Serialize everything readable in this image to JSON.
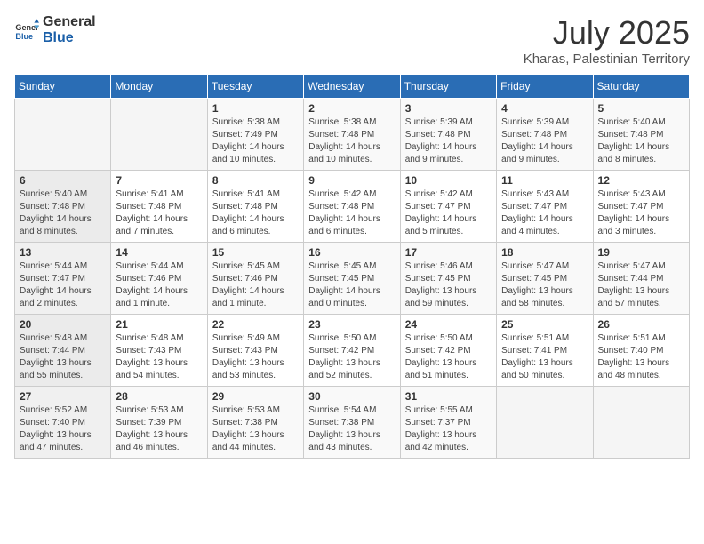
{
  "logo": {
    "line1": "General",
    "line2": "Blue"
  },
  "title": "July 2025",
  "subtitle": "Kharas, Palestinian Territory",
  "days_of_week": [
    "Sunday",
    "Monday",
    "Tuesday",
    "Wednesday",
    "Thursday",
    "Friday",
    "Saturday"
  ],
  "weeks": [
    [
      {
        "day": "",
        "info": ""
      },
      {
        "day": "",
        "info": ""
      },
      {
        "day": "1",
        "info": "Sunrise: 5:38 AM\nSunset: 7:49 PM\nDaylight: 14 hours and 10 minutes."
      },
      {
        "day": "2",
        "info": "Sunrise: 5:38 AM\nSunset: 7:48 PM\nDaylight: 14 hours and 10 minutes."
      },
      {
        "day": "3",
        "info": "Sunrise: 5:39 AM\nSunset: 7:48 PM\nDaylight: 14 hours and 9 minutes."
      },
      {
        "day": "4",
        "info": "Sunrise: 5:39 AM\nSunset: 7:48 PM\nDaylight: 14 hours and 9 minutes."
      },
      {
        "day": "5",
        "info": "Sunrise: 5:40 AM\nSunset: 7:48 PM\nDaylight: 14 hours and 8 minutes."
      }
    ],
    [
      {
        "day": "6",
        "info": "Sunrise: 5:40 AM\nSunset: 7:48 PM\nDaylight: 14 hours and 8 minutes."
      },
      {
        "day": "7",
        "info": "Sunrise: 5:41 AM\nSunset: 7:48 PM\nDaylight: 14 hours and 7 minutes."
      },
      {
        "day": "8",
        "info": "Sunrise: 5:41 AM\nSunset: 7:48 PM\nDaylight: 14 hours and 6 minutes."
      },
      {
        "day": "9",
        "info": "Sunrise: 5:42 AM\nSunset: 7:48 PM\nDaylight: 14 hours and 6 minutes."
      },
      {
        "day": "10",
        "info": "Sunrise: 5:42 AM\nSunset: 7:47 PM\nDaylight: 14 hours and 5 minutes."
      },
      {
        "day": "11",
        "info": "Sunrise: 5:43 AM\nSunset: 7:47 PM\nDaylight: 14 hours and 4 minutes."
      },
      {
        "day": "12",
        "info": "Sunrise: 5:43 AM\nSunset: 7:47 PM\nDaylight: 14 hours and 3 minutes."
      }
    ],
    [
      {
        "day": "13",
        "info": "Sunrise: 5:44 AM\nSunset: 7:47 PM\nDaylight: 14 hours and 2 minutes."
      },
      {
        "day": "14",
        "info": "Sunrise: 5:44 AM\nSunset: 7:46 PM\nDaylight: 14 hours and 1 minute."
      },
      {
        "day": "15",
        "info": "Sunrise: 5:45 AM\nSunset: 7:46 PM\nDaylight: 14 hours and 1 minute."
      },
      {
        "day": "16",
        "info": "Sunrise: 5:45 AM\nSunset: 7:45 PM\nDaylight: 14 hours and 0 minutes."
      },
      {
        "day": "17",
        "info": "Sunrise: 5:46 AM\nSunset: 7:45 PM\nDaylight: 13 hours and 59 minutes."
      },
      {
        "day": "18",
        "info": "Sunrise: 5:47 AM\nSunset: 7:45 PM\nDaylight: 13 hours and 58 minutes."
      },
      {
        "day": "19",
        "info": "Sunrise: 5:47 AM\nSunset: 7:44 PM\nDaylight: 13 hours and 57 minutes."
      }
    ],
    [
      {
        "day": "20",
        "info": "Sunrise: 5:48 AM\nSunset: 7:44 PM\nDaylight: 13 hours and 55 minutes."
      },
      {
        "day": "21",
        "info": "Sunrise: 5:48 AM\nSunset: 7:43 PM\nDaylight: 13 hours and 54 minutes."
      },
      {
        "day": "22",
        "info": "Sunrise: 5:49 AM\nSunset: 7:43 PM\nDaylight: 13 hours and 53 minutes."
      },
      {
        "day": "23",
        "info": "Sunrise: 5:50 AM\nSunset: 7:42 PM\nDaylight: 13 hours and 52 minutes."
      },
      {
        "day": "24",
        "info": "Sunrise: 5:50 AM\nSunset: 7:42 PM\nDaylight: 13 hours and 51 minutes."
      },
      {
        "day": "25",
        "info": "Sunrise: 5:51 AM\nSunset: 7:41 PM\nDaylight: 13 hours and 50 minutes."
      },
      {
        "day": "26",
        "info": "Sunrise: 5:51 AM\nSunset: 7:40 PM\nDaylight: 13 hours and 48 minutes."
      }
    ],
    [
      {
        "day": "27",
        "info": "Sunrise: 5:52 AM\nSunset: 7:40 PM\nDaylight: 13 hours and 47 minutes."
      },
      {
        "day": "28",
        "info": "Sunrise: 5:53 AM\nSunset: 7:39 PM\nDaylight: 13 hours and 46 minutes."
      },
      {
        "day": "29",
        "info": "Sunrise: 5:53 AM\nSunset: 7:38 PM\nDaylight: 13 hours and 44 minutes."
      },
      {
        "day": "30",
        "info": "Sunrise: 5:54 AM\nSunset: 7:38 PM\nDaylight: 13 hours and 43 minutes."
      },
      {
        "day": "31",
        "info": "Sunrise: 5:55 AM\nSunset: 7:37 PM\nDaylight: 13 hours and 42 minutes."
      },
      {
        "day": "",
        "info": ""
      },
      {
        "day": "",
        "info": ""
      }
    ]
  ]
}
